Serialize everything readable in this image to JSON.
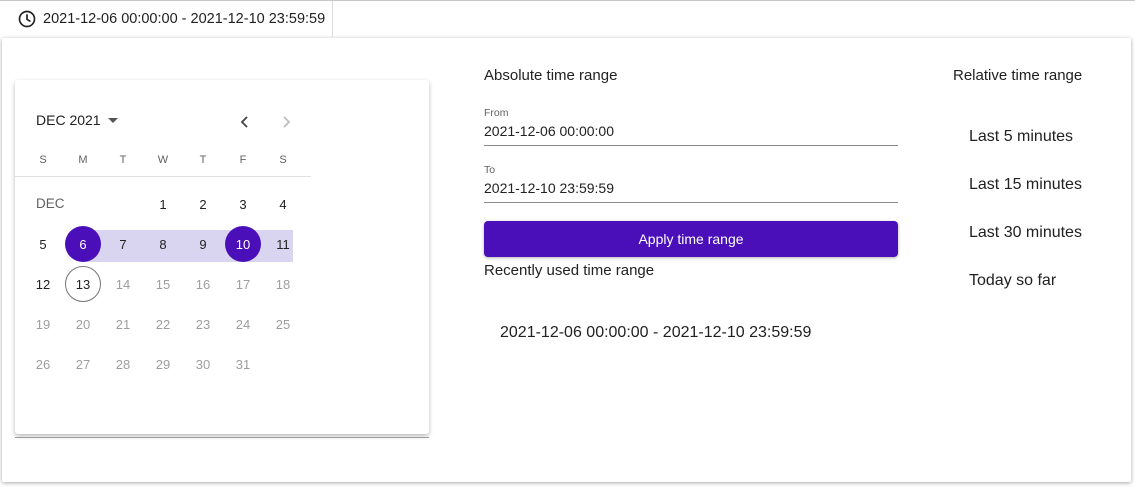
{
  "trigger": {
    "icon": "clock-icon",
    "range_text": "2021-12-06 00:00:00 - 2021-12-10 23:59:59"
  },
  "calendar": {
    "month_button": "DEC 2021",
    "weekdays": [
      "S",
      "M",
      "T",
      "W",
      "T",
      "F",
      "S"
    ],
    "month_label": "DEC",
    "days": [
      {
        "d": "1",
        "row": 0,
        "col": 3,
        "muted": false
      },
      {
        "d": "2",
        "row": 0,
        "col": 4,
        "muted": false
      },
      {
        "d": "3",
        "row": 0,
        "col": 5,
        "muted": false
      },
      {
        "d": "4",
        "row": 0,
        "col": 6,
        "muted": false
      },
      {
        "d": "5",
        "row": 1,
        "col": 0,
        "muted": false
      },
      {
        "d": "6",
        "row": 1,
        "col": 1,
        "muted": false,
        "selected": true
      },
      {
        "d": "7",
        "row": 1,
        "col": 2,
        "muted": false
      },
      {
        "d": "8",
        "row": 1,
        "col": 3,
        "muted": false
      },
      {
        "d": "9",
        "row": 1,
        "col": 4,
        "muted": false
      },
      {
        "d": "10",
        "row": 1,
        "col": 5,
        "muted": false,
        "selected": true
      },
      {
        "d": "11",
        "row": 1,
        "col": 6,
        "muted": false
      },
      {
        "d": "12",
        "row": 2,
        "col": 0,
        "muted": false
      },
      {
        "d": "13",
        "row": 2,
        "col": 1,
        "muted": false,
        "today": true
      },
      {
        "d": "14",
        "row": 2,
        "col": 2,
        "muted": true
      },
      {
        "d": "15",
        "row": 2,
        "col": 3,
        "muted": true
      },
      {
        "d": "16",
        "row": 2,
        "col": 4,
        "muted": true
      },
      {
        "d": "17",
        "row": 2,
        "col": 5,
        "muted": true
      },
      {
        "d": "18",
        "row": 2,
        "col": 6,
        "muted": true
      },
      {
        "d": "19",
        "row": 3,
        "col": 0,
        "muted": true
      },
      {
        "d": "20",
        "row": 3,
        "col": 1,
        "muted": true
      },
      {
        "d": "21",
        "row": 3,
        "col": 2,
        "muted": true
      },
      {
        "d": "22",
        "row": 3,
        "col": 3,
        "muted": true
      },
      {
        "d": "23",
        "row": 3,
        "col": 4,
        "muted": true
      },
      {
        "d": "24",
        "row": 3,
        "col": 5,
        "muted": true
      },
      {
        "d": "25",
        "row": 3,
        "col": 6,
        "muted": true
      },
      {
        "d": "26",
        "row": 4,
        "col": 0,
        "muted": true
      },
      {
        "d": "27",
        "row": 4,
        "col": 1,
        "muted": true
      },
      {
        "d": "28",
        "row": 4,
        "col": 2,
        "muted": true
      },
      {
        "d": "29",
        "row": 4,
        "col": 3,
        "muted": true
      },
      {
        "d": "30",
        "row": 4,
        "col": 4,
        "muted": true
      },
      {
        "d": "31",
        "row": 4,
        "col": 5,
        "muted": true
      }
    ]
  },
  "absolute": {
    "title": "Absolute time range",
    "from_label": "From",
    "from_value": "2021-12-06 00:00:00",
    "to_label": "To",
    "to_value": "2021-12-10 23:59:59",
    "apply_label": "Apply time range",
    "recent_title": "Recently used time range",
    "recent_items": [
      "2021-12-06 00:00:00 - 2021-12-10 23:59:59"
    ]
  },
  "relative": {
    "title": "Relative time range",
    "items": [
      "Last 5 minutes",
      "Last 15 minutes",
      "Last 30 minutes",
      "Today so far"
    ]
  },
  "colors": {
    "accent": "#4a0fb8",
    "range_band": "#d9d5f0"
  }
}
